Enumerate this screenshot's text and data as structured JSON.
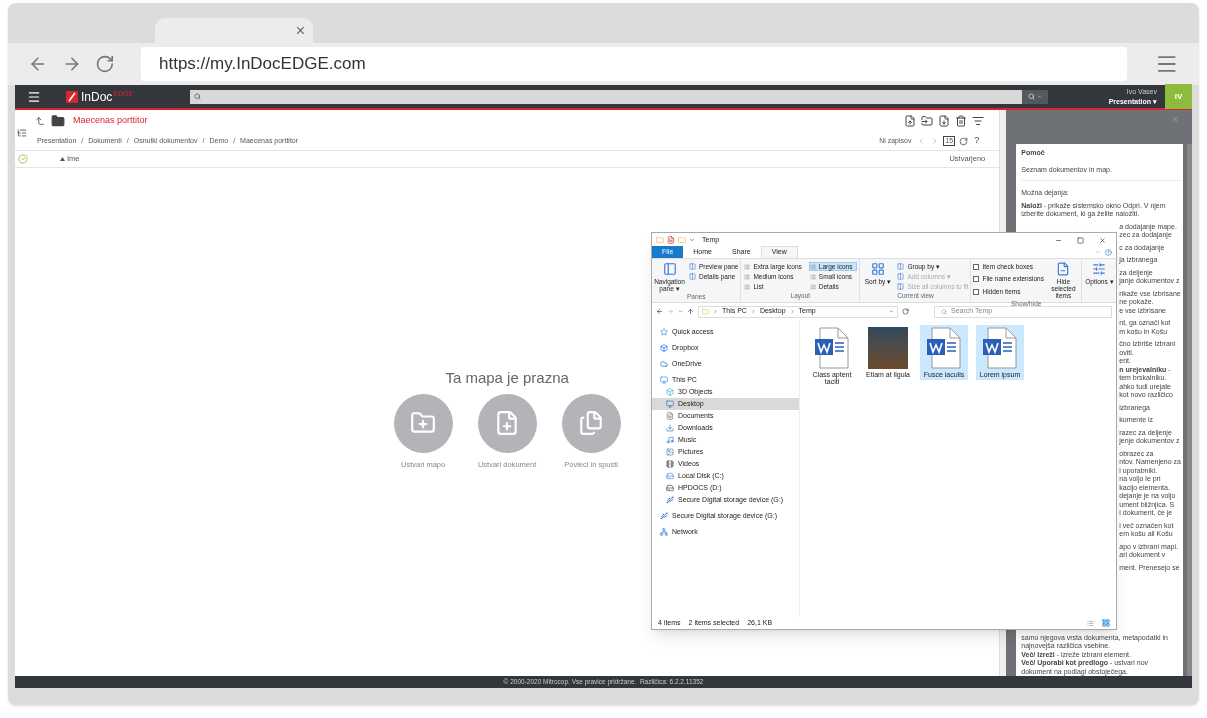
{
  "browser": {
    "tab_close": "×",
    "url": "https://my.InDocEDGE.com"
  },
  "app": {
    "logo": "InDoc",
    "logo_sup": "EDGE",
    "user_name": "Ivo Vasev",
    "user_menu": "Presentation ▾",
    "avatar": "IV"
  },
  "folder": {
    "title": "Maecenas porttitor",
    "breadcrumbs": [
      "Presentation",
      "Dokumenti",
      "Osnutki dokumentov",
      "Demo",
      "Maecenas porttitor"
    ],
    "separator": "/",
    "no_records": "Ni zapisov",
    "page_size": "15",
    "help_mark": "?"
  },
  "columns": [
    {
      "label": "Ime",
      "sorted": true
    },
    {
      "label": "Ustvarjeno",
      "sorted": false
    }
  ],
  "empty": {
    "title": "Ta mapa je prazna",
    "actions": [
      {
        "kind": "folder",
        "label": "Ustvari mapo"
      },
      {
        "kind": "document",
        "label": "Ustvari dokument"
      },
      {
        "kind": "drag",
        "label": "Povleci in spusti"
      }
    ]
  },
  "help": {
    "close": "×",
    "paragraphs": [
      {
        "kind": "title",
        "lines": [
          "Pomoč"
        ]
      },
      {
        "kind": "full",
        "lines": [
          "Seznam dokumentov in map."
        ]
      },
      {
        "kind": "full",
        "lines": [
          "Možna dejanja:"
        ]
      },
      {
        "kind": "full",
        "lines": [
          "**Naloži** - prikaže sistemsko okno Odpri. V njem",
          "izberite dokument, ki ga želite naložiti."
        ]
      },
      {
        "kind": "partial",
        "lines": [
          "a dodajanje mape.",
          "zec za dodajanje"
        ]
      },
      {
        "kind": "partial",
        "lines": [
          "c za dodajanje"
        ]
      },
      {
        "kind": "partial",
        "lines": [
          "ja izbranega"
        ]
      },
      {
        "kind": "partial",
        "lines": [
          "za deljenje",
          "janje dokumentov z"
        ]
      },
      {
        "kind": "partial",
        "lines": [
          "rikaže vse izbrisane",
          "ne pokaže.",
          "e vse izbrisane"
        ]
      },
      {
        "kind": "partial",
        "lines": [
          "nt, ga označi kot",
          "m košu in Košu"
        ]
      },
      {
        "kind": "partial",
        "lines": [
          "čno izbriše izbrani",
          "oviti.",
          "ent.",
          "**n urejevalniku** -",
          "tem brskalniku.",
          "ahko tudi urejate",
          "kot novo različico"
        ]
      },
      {
        "kind": "partial",
        "lines": [
          "izbranega"
        ]
      },
      {
        "kind": "partial",
        "lines": [
          "kumente iz"
        ]
      },
      {
        "kind": "partial",
        "lines": [
          "razec za deljenje",
          "jenje dokumentov z"
        ]
      },
      {
        "kind": "partial",
        "lines": [
          "obrazec za",
          "ntov. Namenjeno za",
          "i uporabniki.",
          "na voljo le pri",
          "kacijo elementa.",
          "dejanje je na voljo",
          "ument bližnjica. S",
          "i dokument, če je"
        ]
      },
      {
        "kind": "partial",
        "lines": [
          "i več označen kot",
          "em košu ali Košu"
        ]
      },
      {
        "kind": "partial",
        "lines": [
          "apo v izbrani mapi.",
          "ari dokument v"
        ]
      },
      {
        "kind": "partial",
        "lines": [
          "ment. Prenesejo se"
        ]
      },
      {
        "kind": "full",
        "lines": [
          "samo njegova vrsta dokumenta, metapodatki in",
          "najnovejša različica vsebine.",
          "**Več/ Izreži** - izreže izbrani element.",
          "**Več/ Uporabi kot predlogo** - ustvari nov",
          "dokument na podlagi obstoječega."
        ]
      }
    ]
  },
  "footer": "© 2000-2020 Mitrocop. Vse pravice pridržane.  Različica: 6.2.2.11352",
  "explorer": {
    "title": "Temp",
    "tabs": [
      {
        "label": "File",
        "kind": "file",
        "selected": false
      },
      {
        "label": "Home",
        "kind": "tab",
        "selected": false
      },
      {
        "label": "Share",
        "kind": "tab",
        "selected": false
      },
      {
        "label": "View",
        "kind": "tab",
        "selected": true
      }
    ],
    "groups": [
      {
        "label": "Panes",
        "items": [
          {
            "kind": "big",
            "label": "Navigation pane ▾"
          },
          {
            "kind": "small",
            "label": "Preview pane"
          },
          {
            "kind": "small",
            "label": "Details pane"
          }
        ]
      },
      {
        "label": "Layout",
        "items": [
          {
            "kind": "option",
            "label": "Extra large icons",
            "selected": false
          },
          {
            "kind": "option",
            "label": "Medium icons",
            "selected": false
          },
          {
            "kind": "option",
            "label": "List",
            "selected": false
          },
          {
            "kind": "option",
            "label": "Large icons",
            "selected": true
          },
          {
            "kind": "option",
            "label": "Small icons",
            "selected": false
          },
          {
            "kind": "option",
            "label": "Details",
            "selected": false
          }
        ]
      },
      {
        "label": "Current view",
        "items": [
          {
            "kind": "big",
            "label": "Sort by ▾"
          },
          {
            "kind": "small",
            "label": "Group by ▾",
            "disabled": false
          },
          {
            "kind": "small",
            "label": "Add columns ▾",
            "disabled": true
          },
          {
            "kind": "small",
            "label": "Size all columns to fit",
            "disabled": true
          }
        ]
      },
      {
        "label": "Show/hide",
        "items": [
          {
            "kind": "check",
            "label": "Item check boxes",
            "checked": false
          },
          {
            "kind": "check",
            "label": "File name extensions",
            "checked": false
          },
          {
            "kind": "check",
            "label": "Hidden items",
            "checked": false
          },
          {
            "kind": "big",
            "label": "Hide selected items"
          }
        ]
      },
      {
        "items": [
          {
            "kind": "big",
            "label": "Options ▾"
          }
        ]
      }
    ],
    "path": [
      "This PC",
      "Desktop",
      "Temp"
    ],
    "search_placeholder": "Search Temp",
    "nav": [
      {
        "label": "Quick access",
        "kind": "star",
        "selected": false
      },
      {
        "label": "Dropbox",
        "kind": "box",
        "selected": false
      },
      {
        "label": "OneDrive",
        "kind": "cloud",
        "selected": false
      },
      {
        "label": "This PC",
        "kind": "computer",
        "selected": false,
        "children": [
          {
            "label": "3D Objects",
            "kind": "cube",
            "selected": false
          },
          {
            "label": "Desktop",
            "kind": "desktop",
            "selected": true
          },
          {
            "label": "Documents",
            "kind": "documents",
            "selected": false
          },
          {
            "label": "Downloads",
            "kind": "downloads",
            "selected": false
          },
          {
            "label": "Music",
            "kind": "music",
            "selected": false
          },
          {
            "label": "Pictures",
            "kind": "pictures",
            "selected": false
          },
          {
            "label": "Videos",
            "kind": "videos",
            "selected": false
          },
          {
            "label": "Local Disk (C:)",
            "kind": "disk",
            "selected": false
          },
          {
            "label": "HPDOCS (D:)",
            "kind": "drive",
            "selected": false
          },
          {
            "label": "Secure Digital storage device (G:)",
            "kind": "usb",
            "selected": false
          }
        ]
      },
      {
        "label": "Secure Digital storage device (G:)",
        "kind": "usb",
        "selected": false
      },
      {
        "label": "Network",
        "kind": "network",
        "selected": false
      }
    ],
    "files": [
      {
        "name": "Class aptent taciti",
        "kind": "document",
        "selected": false
      },
      {
        "name": "Etiam at ligula",
        "kind": "image",
        "selected": false
      },
      {
        "name": "Fusce iaculis",
        "kind": "document",
        "selected": true
      },
      {
        "name": "Lorem ipsum",
        "kind": "document",
        "selected": true
      }
    ],
    "status_items": "4 items",
    "status_selected": "2 items selected",
    "status_size": "26,1 KB"
  }
}
